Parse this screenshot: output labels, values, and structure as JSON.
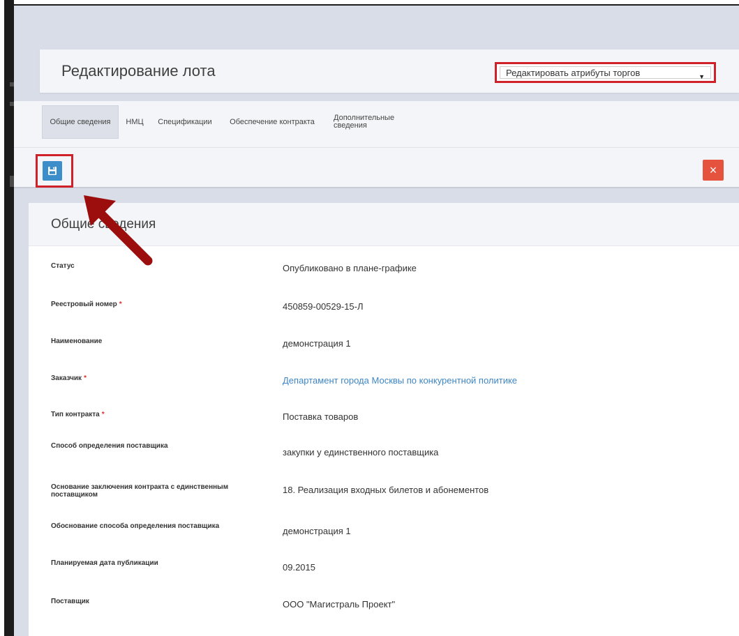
{
  "header": {
    "title": "Редактирование лота",
    "action_select": {
      "value": "Редактировать атрибуты торгов"
    }
  },
  "tabs": [
    {
      "label": "Общие сведения"
    },
    {
      "label": "НМЦ"
    },
    {
      "label": "Спецификации"
    },
    {
      "label": "Обеспечение контракта"
    },
    {
      "label_line1": "Дополнительные",
      "label_line2": "сведения"
    }
  ],
  "toolbar": {
    "close_label": "×"
  },
  "section": {
    "title": "Общие сведения",
    "fields": [
      {
        "label": "Статус",
        "value": "Опубликовано в плане-графике",
        "required": false
      },
      {
        "label": "Реестровый номер",
        "value": "450859-00529-15-Л",
        "required": true
      },
      {
        "label": "Наименование",
        "value": "демонстрация 1",
        "required": false
      },
      {
        "label": "Заказчик",
        "value": "Департамент города Москвы по конкурентной политике",
        "required": true
      },
      {
        "label": "Тип контракта",
        "value": "Поставка товаров",
        "required": true
      },
      {
        "label": "Способ определения поставщика",
        "value": "закупки у единственного поставщика",
        "required": false
      },
      {
        "label": "Основание заключения контракта с единственным поставщиком",
        "value": "18. Реализация входных билетов и абонементов",
        "required": false
      },
      {
        "label": "Обоснование способа определения поставщика",
        "value": "демонстрация 1",
        "required": false
      },
      {
        "label": "Планируемая дата публикации",
        "value": "09.2015",
        "required": false
      },
      {
        "label": "Поставщик",
        "value": "ООО \"Магистраль Проект\"",
        "required": false
      }
    ]
  },
  "required_marker": "*",
  "colors": {
    "accent_red": "#d0202a",
    "save_blue": "#3b8ec9",
    "close_red": "#e5533f",
    "link_blue": "#3f86c4",
    "arrow_red": "#9c0d0d"
  },
  "icons": {
    "save": "floppy-disk-icon",
    "close": "close-icon",
    "caret": "caret-down-icon"
  }
}
